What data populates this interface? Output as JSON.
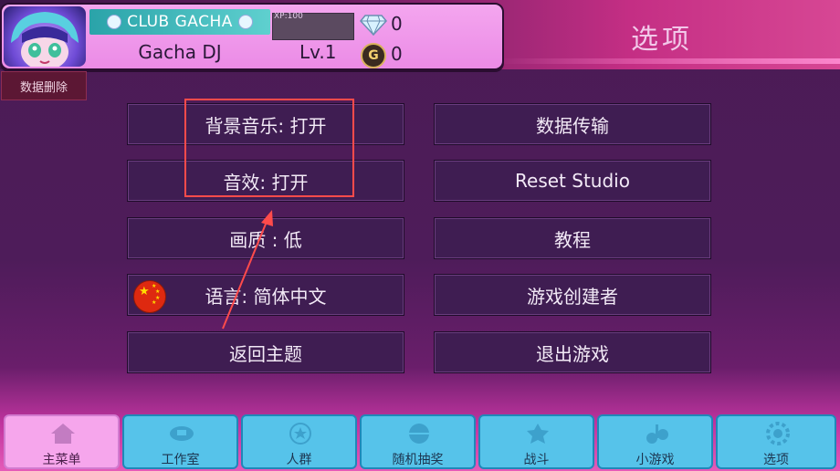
{
  "header": {
    "club_label": "CLUB GACHA",
    "xp_label": "XP:100",
    "player_name": "Gacha DJ",
    "level": "Lv.1",
    "gems": "0",
    "gold": "0",
    "gold_symbol": "G",
    "page_title": "选项"
  },
  "delete_data_button": "数据删除",
  "options_left": [
    {
      "label": "背景音乐: 打开"
    },
    {
      "label": "音效: 打开"
    },
    {
      "label": "画质 : 低"
    },
    {
      "label": "语言: 简体中文"
    },
    {
      "label": "返回主题"
    }
  ],
  "options_right": [
    {
      "label": "数据传输"
    },
    {
      "label": "Reset Studio"
    },
    {
      "label": "教程"
    },
    {
      "label": "游戏创建者"
    },
    {
      "label": "退出游戏"
    }
  ],
  "nav": [
    {
      "label": "主菜单",
      "icon": "home-icon",
      "active": true
    },
    {
      "label": "工作室",
      "icon": "studio-icon",
      "active": false
    },
    {
      "label": "人群",
      "icon": "crowd-icon",
      "active": false
    },
    {
      "label": "随机抽奖",
      "icon": "gacha-icon",
      "active": false
    },
    {
      "label": "战斗",
      "icon": "battle-icon",
      "active": false
    },
    {
      "label": "小游戏",
      "icon": "minigame-icon",
      "active": false
    },
    {
      "label": "选项",
      "icon": "options-gear-icon",
      "active": false
    }
  ],
  "colors": {
    "highlight": "#ff4b4b",
    "nav_tab": "#56c3ea",
    "nav_active": "#f6a6ec",
    "option_button": "#3f1d52"
  }
}
